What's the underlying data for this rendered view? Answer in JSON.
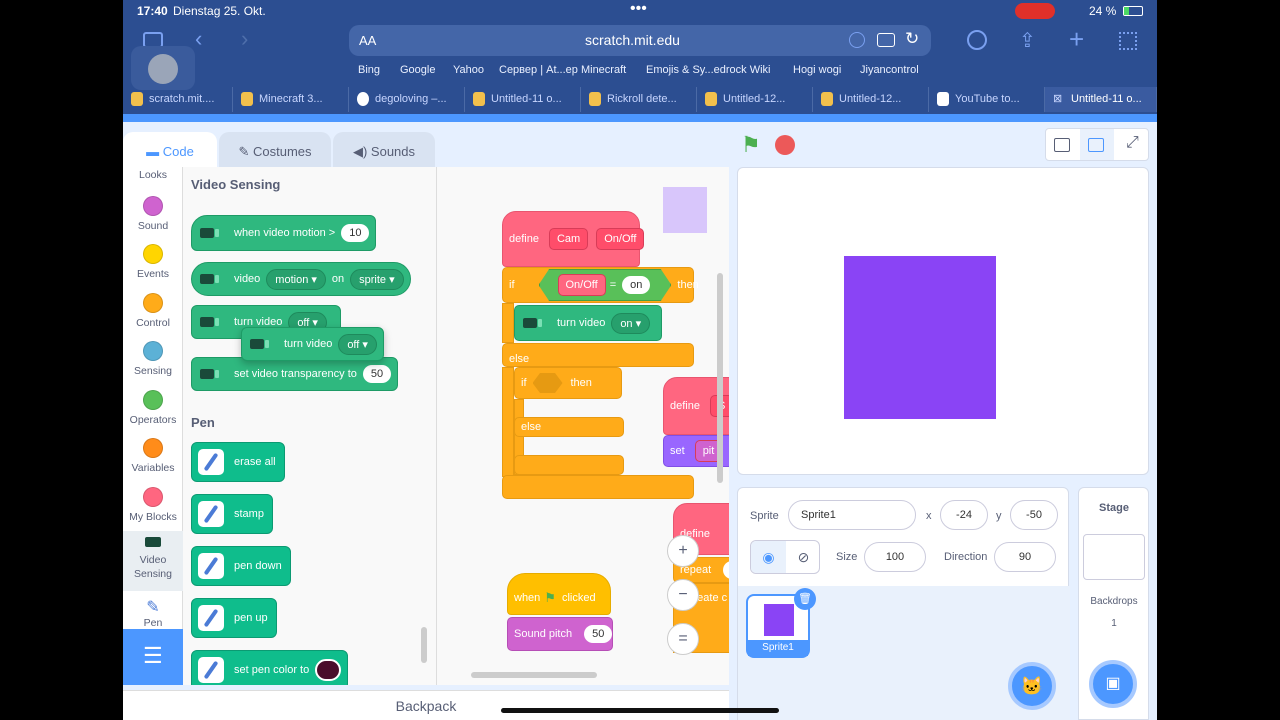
{
  "status": {
    "time": "17:40",
    "date": "Dienstag 25. Okt.",
    "battery": "24 %"
  },
  "browser": {
    "text_size": "AA",
    "url": "scratch.mit.edu",
    "favorites": [
      "Bing",
      "Google",
      "Yahoo",
      "Сервер | At...ep Minecraft",
      "Emojis & Sy...edrock Wiki",
      "Hogi wogi",
      "Jiyancontrol"
    ],
    "tabs": [
      "scratch.mit....",
      "Minecraft 3...",
      "degoloving –...",
      "Untitled-11 o...",
      "Rickroll dete...",
      "Untitled-12...",
      "Untitled-12...",
      "YouTube to...",
      "Untitled-11 o..."
    ]
  },
  "editor_tabs": {
    "code": "Code",
    "costumes": "Costumes",
    "sounds": "Sounds"
  },
  "categories": [
    {
      "label": "Looks",
      "color": "#9966ff"
    },
    {
      "label": "Sound",
      "color": "#cf63cf"
    },
    {
      "label": "Events",
      "color": "#ffd500"
    },
    {
      "label": "Control",
      "color": "#ffab19"
    },
    {
      "label": "Sensing",
      "color": "#5cb1d6"
    },
    {
      "label": "Operators",
      "color": "#59c059"
    },
    {
      "label": "Variables",
      "color": "#ff8c1a"
    },
    {
      "label": "My Blocks",
      "color": "#ff6680"
    },
    {
      "label": "Video\nSensing",
      "color": "#2fb87f"
    },
    {
      "label": "Pen",
      "color": "#0fbd8c"
    }
  ],
  "palette": {
    "video_title": "Video Sensing",
    "b1": {
      "text": "when video motion >",
      "val": "10"
    },
    "b2": {
      "text": "video",
      "dd1": "motion",
      "mid": "on",
      "dd2": "sprite"
    },
    "b3": {
      "text": "turn video",
      "dd": "off"
    },
    "b3drag": {
      "text": "turn video",
      "dd": "off"
    },
    "b4": {
      "text": "set video transparency to",
      "val": "50"
    },
    "pen_title": "Pen",
    "p1": "erase all",
    "p2": "stamp",
    "p3": "pen down",
    "p4": "pen up",
    "p5": "set pen color to"
  },
  "script": {
    "define": "define",
    "cam": "Cam",
    "onoff": "On/Off",
    "if": "if",
    "cond_left": "On/Off",
    "eq": "=",
    "cond_right": "on",
    "then": "then",
    "turn": "turn video",
    "turn_dd": "on",
    "else": "else",
    "if2": "if",
    "then2": "then",
    "else2": "else",
    "define2": "define",
    "define2_arg": "S",
    "set": "set",
    "set_arg": "pit",
    "define3": "define",
    "repeat": "repeat",
    "repeat_arg": "c",
    "create": "create c",
    "when": "when",
    "clicked": "clicked",
    "sound": "Sound pitch",
    "sound_val": "50"
  },
  "zoom": {
    "in": "+",
    "out": "−",
    "reset": "="
  },
  "sprite": {
    "label": "Sprite",
    "name": "Sprite1",
    "x_label": "x",
    "x": "-24",
    "y_label": "y",
    "y": "-50",
    "size_label": "Size",
    "size": "100",
    "dir_label": "Direction",
    "dir": "90",
    "thumb_name": "Sprite1",
    "color": "#8a44f5"
  },
  "stage_pane": {
    "title": "Stage",
    "backdrops_label": "Backdrops",
    "backdrops_count": "1"
  },
  "backpack": "Backpack"
}
